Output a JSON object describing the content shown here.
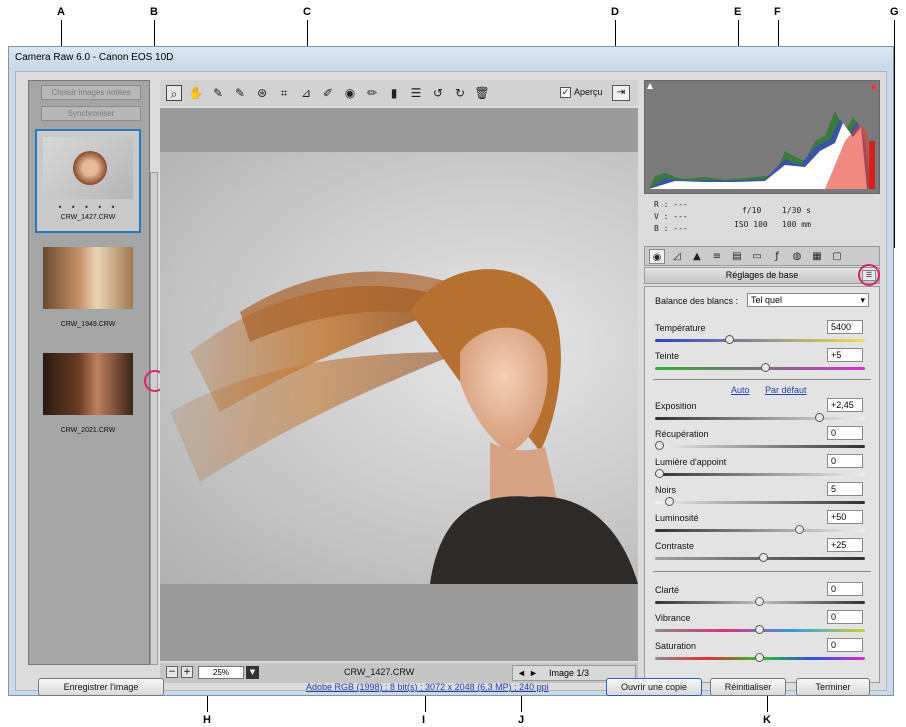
{
  "window": {
    "title": "Camera Raw 6.0  -  Canon EOS 10D"
  },
  "callouts": [
    "A",
    "B",
    "C",
    "D",
    "E",
    "F",
    "G",
    "H",
    "I",
    "J",
    "K"
  ],
  "filmstrip": {
    "select_rated_label": "Choisir images notées",
    "sync_label": "Synchroniser",
    "thumbnails": [
      {
        "name": "CRW_1427.CRW",
        "selected": true
      },
      {
        "name": "CRW_1949.CRW",
        "selected": false
      },
      {
        "name": "CRW_2021.CRW",
        "selected": false
      }
    ],
    "rating_dots": "• • • • •"
  },
  "toolbar": {
    "tools": [
      "zoom-tool-icon",
      "hand-tool-icon",
      "white-balance-tool-icon",
      "color-sampler-tool-icon",
      "target-adjustment-tool-icon",
      "crop-tool-icon",
      "straighten-tool-icon",
      "spot-removal-tool-icon",
      "red-eye-tool-icon",
      "adjustment-brush-icon",
      "graduated-filter-icon",
      "preferences-icon",
      "rotate-left-icon",
      "rotate-right-icon",
      "trash-icon"
    ],
    "tool_glyphs": [
      "⌕",
      "✋",
      "✎",
      "✎",
      "⊛",
      "⌗",
      "⊿",
      "✐",
      "◉",
      "✏",
      "▮",
      "☰",
      "↺",
      "↻",
      "🗑"
    ],
    "preview_label": "Aperçu",
    "preview_checked": true
  },
  "status": {
    "zoom": "25%",
    "filename": "CRW_1427.CRW",
    "image_counter": "Image 1/3"
  },
  "readout": {
    "r": "R :  ---",
    "v": "V :  ---",
    "b": "B :  ---",
    "aperture": "f/10",
    "shutter": "1/30 s",
    "iso": "ISO 100",
    "focal": "100 mm"
  },
  "panel": {
    "title": "Réglages de base",
    "white_balance_label": "Balance des blancs :",
    "white_balance_value": "Tel quel",
    "auto_link": "Auto",
    "default_link": "Par défaut",
    "sliders": [
      {
        "label": "Température",
        "value": "5400",
        "pos": 0.35
      },
      {
        "label": "Teinte",
        "value": "+5",
        "pos": 0.53
      },
      {
        "label": "Exposition",
        "value": "+2,45",
        "pos": 0.8
      },
      {
        "label": "Récupération",
        "value": "0",
        "pos": 0.0
      },
      {
        "label": "Lumière d'appoint",
        "value": "0",
        "pos": 0.0
      },
      {
        "label": "Noirs",
        "value": "5",
        "pos": 0.05
      },
      {
        "label": "Luminosité",
        "value": "+50",
        "pos": 0.7
      },
      {
        "label": "Contraste",
        "value": "+25",
        "pos": 0.52
      },
      {
        "label": "Clarté",
        "value": "0",
        "pos": 0.5
      },
      {
        "label": "Vibrance",
        "value": "0",
        "pos": 0.5
      },
      {
        "label": "Saturation",
        "value": "0",
        "pos": 0.5
      }
    ]
  },
  "bottom": {
    "save_label": "Enregistrer l'image",
    "workflow_text": "Adobe RGB (1998) ; 8 bit(s) ; 3072 x 2048 (6,3 MP) ; 240 ppi",
    "open_copy_label": "Ouvrir une copie",
    "reset_label": "Réinitialiser",
    "done_label": "Terminer"
  }
}
